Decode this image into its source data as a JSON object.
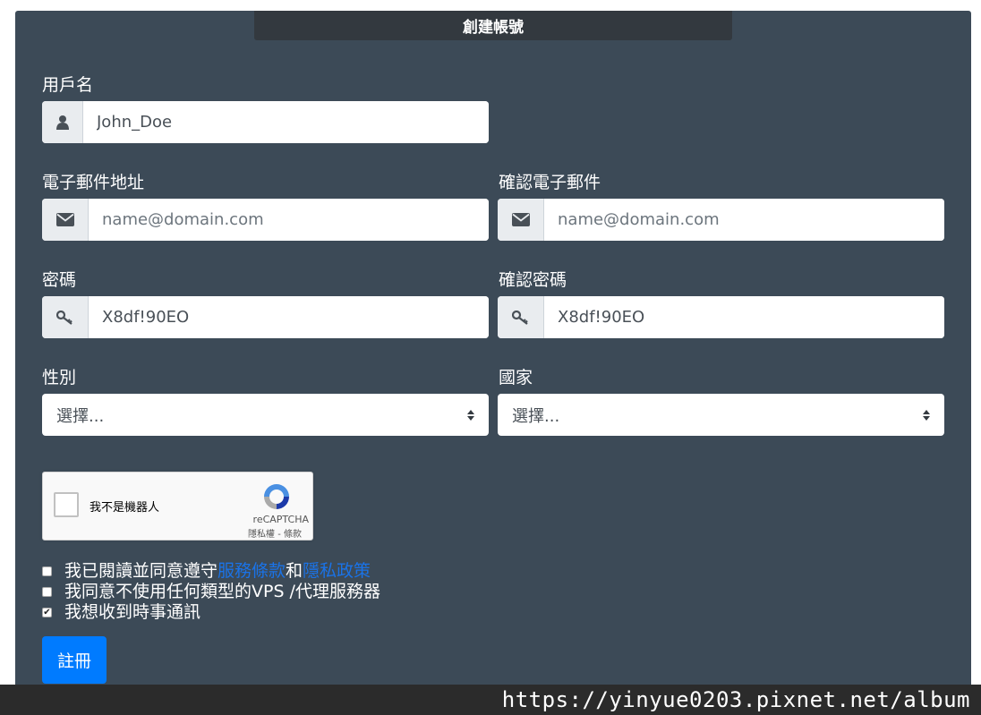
{
  "form": {
    "title": "創建帳號",
    "username": {
      "label": "用戶名",
      "value": "John_Doe"
    },
    "email": {
      "label": "電子郵件地址",
      "placeholder": "name@domain.com"
    },
    "confirm_email": {
      "label": "確認電子郵件",
      "placeholder": "name@domain.com"
    },
    "password": {
      "label": "密碼",
      "value": "X8df!90EO"
    },
    "confirm_password": {
      "label": "確認密碼",
      "value": "X8df!90EO"
    },
    "gender": {
      "label": "性別",
      "selected": "選擇..."
    },
    "country": {
      "label": "國家",
      "selected": "選擇..."
    },
    "captcha": {
      "label": "我不是機器人",
      "brand": "reCAPTCHA",
      "terms": "隱私權 - 條款"
    },
    "agreements": [
      {
        "prefix": "我已閱讀並同意遵守",
        "link1": "服務條款",
        "middle": "和",
        "link2": "隱私政策",
        "checked": false
      },
      {
        "text": "我同意不使用任何類型的VPS /代理服務器",
        "checked": false
      },
      {
        "text": "我想收到時事通訊",
        "checked": true
      }
    ],
    "submit_label": "註冊"
  },
  "watermark": "https://yinyue0203.pixnet.net/album",
  "icons": {
    "username": "user-icon",
    "email": "envelope-icon",
    "password": "key-icon",
    "select": "select-caret-icon",
    "captcha": "recaptcha-logo-icon",
    "checkmark": "checkmark-icon"
  },
  "colors": {
    "panel": "#3c4a57",
    "title_bar": "#33393f",
    "button": "#007bff",
    "link": "#1a73e8"
  }
}
